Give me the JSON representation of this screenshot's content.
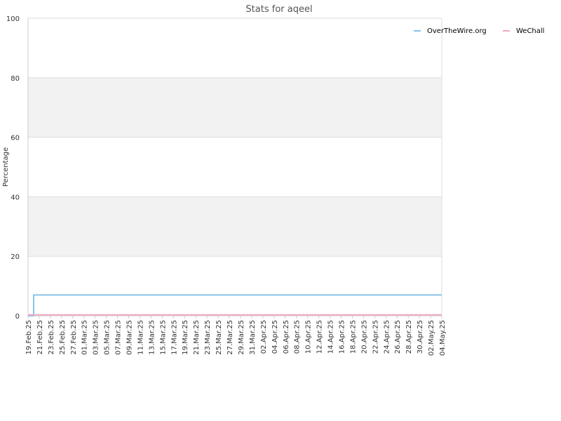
{
  "chart_data": {
    "type": "line",
    "title": "Stats for aqeel",
    "xlabel": "",
    "ylabel": "Percentage",
    "ylim": [
      0,
      100
    ],
    "yticks": [
      0,
      20,
      40,
      60,
      80,
      100
    ],
    "grid": true,
    "banded_background": true,
    "legend_position": "top-right",
    "x_range": [
      "2025-02-19",
      "2025-05-04"
    ],
    "xtick_labels": [
      "19.Feb.25",
      "21.Feb.25",
      "23.Feb.25",
      "25.Feb.25",
      "27.Feb.25",
      "01.Mar.25",
      "03.Mar.25",
      "05.Mar.25",
      "07.Mar.25",
      "09.Mar.25",
      "11.Mar.25",
      "13.Mar.25",
      "15.Mar.25",
      "17.Mar.25",
      "19.Mar.25",
      "21.Mar.25",
      "23.Mar.25",
      "25.Mar.25",
      "27.Mar.25",
      "29.Mar.25",
      "31.Mar.25",
      "02.Apr.25",
      "04.Apr.25",
      "06.Apr.25",
      "08.Apr.25",
      "10.Apr.25",
      "12.Apr.25",
      "14.Apr.25",
      "16.Apr.25",
      "18.Apr.25",
      "20.Apr.25",
      "22.Apr.25",
      "24.Apr.25",
      "26.Apr.25",
      "28.Apr.25",
      "30.Apr.25",
      "02.May.25",
      "04.May.25"
    ],
    "series": [
      {
        "name": "OverTheWire.org",
        "color": "#87c4e6",
        "points": [
          {
            "x": "2025-02-19",
            "y": 0
          },
          {
            "x": "2025-02-20",
            "y": 0
          },
          {
            "x": "2025-02-20",
            "y": 7
          },
          {
            "x": "2025-05-04",
            "y": 7
          }
        ]
      },
      {
        "name": "WeChall",
        "color": "#f2a7c3",
        "points": [
          {
            "x": "2025-02-19",
            "y": 0.3
          },
          {
            "x": "2025-05-04",
            "y": 0.3
          }
        ]
      }
    ]
  }
}
